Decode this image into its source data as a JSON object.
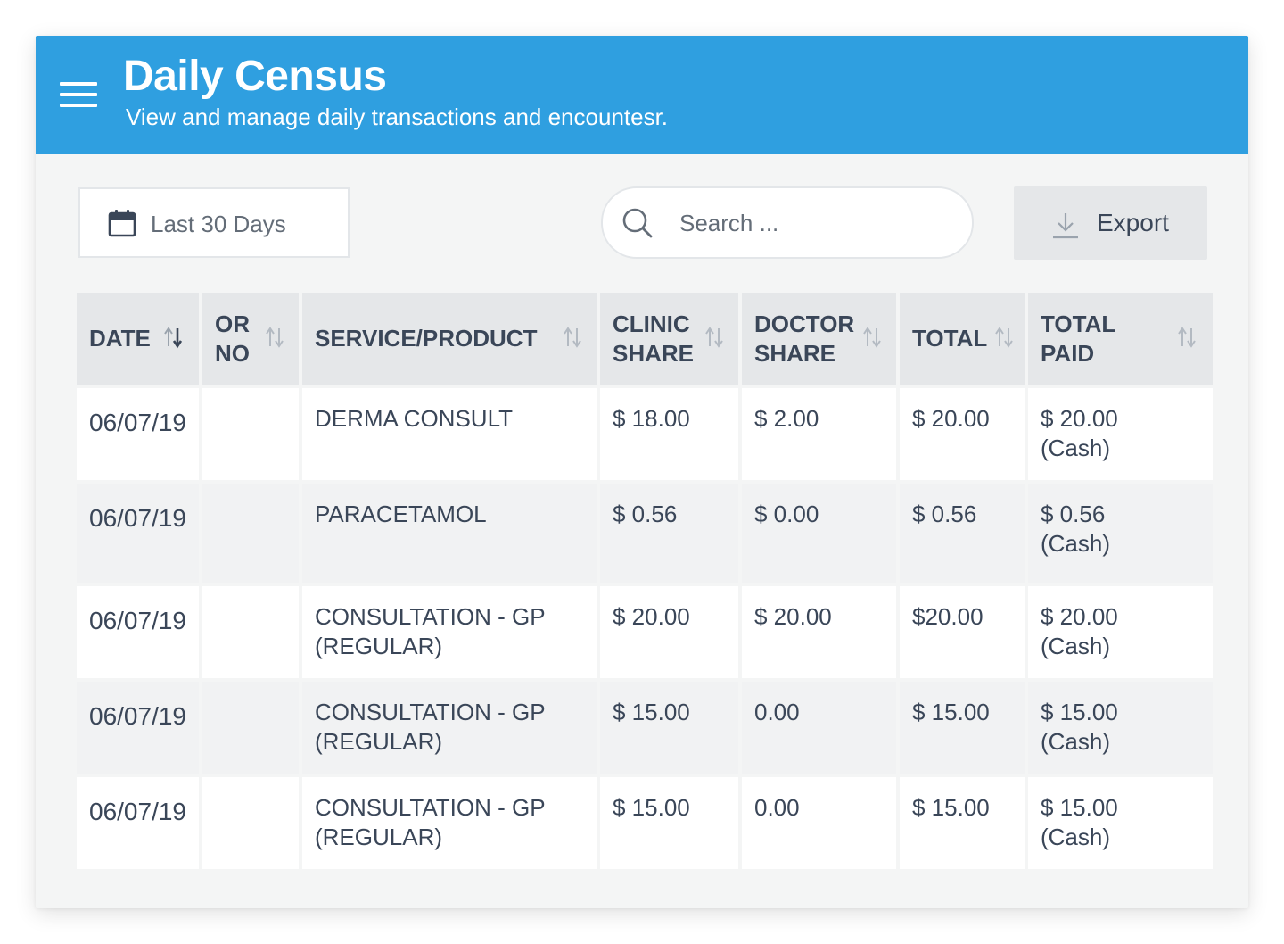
{
  "header": {
    "title": "Daily Census",
    "subtitle": "View and manage daily transactions and encountesr."
  },
  "toolbar": {
    "date_range_label": "Last 30 Days",
    "search_placeholder": "Search ...",
    "export_label": "Export"
  },
  "icons": {
    "menu": "hamburger-menu-icon",
    "calendar": "calendar-icon",
    "search": "search-icon",
    "export": "download-icon",
    "sort": "sort-arrows-icon"
  },
  "colors": {
    "header_bg": "#2f9fe0",
    "card_bg": "#f4f5f5",
    "table_header_bg": "#e5e7e9",
    "row_alt_bg": "#f1f2f3",
    "text": "#3a4658"
  },
  "table": {
    "columns": [
      "DATE",
      "OR NO",
      "SERVICE/PRODUCT",
      "CLINIC SHARE",
      "DOCTOR SHARE",
      "TOTAL",
      "TOTAL PAID"
    ],
    "active_sort_column": "DATE",
    "rows": [
      {
        "date": "06/07/19",
        "or_no": "",
        "service": "DERMA CONSULT",
        "clinic_share": "$ 18.00",
        "doctor_share": "$ 2.00",
        "total": "$ 20.00",
        "total_paid": "$ 20.00",
        "payment_method": "(Cash)"
      },
      {
        "date": "06/07/19",
        "or_no": "",
        "service": "PARACETAMOL",
        "clinic_share": "$ 0.56",
        "doctor_share": "$ 0.00",
        "total": "$ 0.56",
        "total_paid": "$ 0.56",
        "payment_method": "(Cash)"
      },
      {
        "date": "06/07/19",
        "or_no": "",
        "service": "CONSULTATION - GP (REGULAR)",
        "clinic_share": "$ 20.00",
        "doctor_share": "$ 20.00",
        "total": "$20.00",
        "total_paid": "$ 20.00",
        "payment_method": "(Cash)"
      },
      {
        "date": "06/07/19",
        "or_no": "",
        "service": "CONSULTATION - GP (REGULAR)",
        "clinic_share": "$ 15.00",
        "doctor_share": "0.00",
        "total": "$ 15.00",
        "total_paid": "$ 15.00",
        "payment_method": "(Cash)"
      },
      {
        "date": "06/07/19",
        "or_no": "",
        "service": "CONSULTATION - GP (REGULAR)",
        "clinic_share": "$ 15.00",
        "doctor_share": "0.00",
        "total": "$ 15.00",
        "total_paid": "$ 15.00",
        "payment_method": "(Cash)"
      }
    ]
  }
}
